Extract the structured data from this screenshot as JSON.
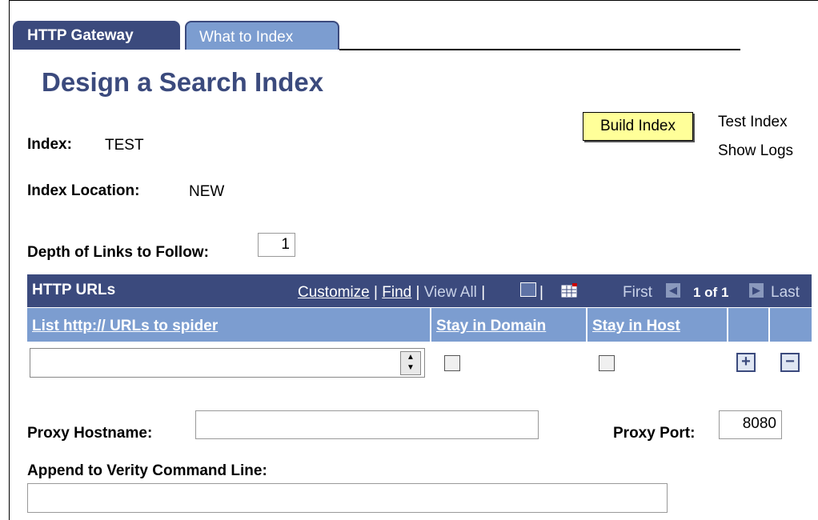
{
  "tabs": [
    {
      "label": "HTTP Gateway",
      "active": true
    },
    {
      "label": "What to Index",
      "active": false
    }
  ],
  "page_title": "Design a Search Index",
  "actions": {
    "build_index": "Build Index",
    "test_index": "Test Index",
    "show_logs": "Show Logs"
  },
  "index": {
    "label": "Index:",
    "value": "TEST"
  },
  "index_location": {
    "label": "Index Location:",
    "value": "NEW"
  },
  "depth": {
    "label": "Depth of Links to Follow:",
    "value": "1"
  },
  "grid": {
    "title": "HTTP URLs",
    "customize": "Customize",
    "find": "Find",
    "view_all": "View All",
    "first": "First",
    "page_info": "1 of 1",
    "last": "Last",
    "columns": [
      "List http:// URLs to spider",
      "Stay in Domain",
      "Stay in Host"
    ],
    "row": {
      "url": "",
      "stay_in_domain": false,
      "stay_in_host": false
    },
    "add_symbol": "+",
    "remove_symbol": "−"
  },
  "proxy_hostname": {
    "label": "Proxy Hostname:",
    "value": ""
  },
  "proxy_port": {
    "label": "Proxy Port:",
    "value": "8080"
  },
  "append_cmd": {
    "label": "Append to Verity Command Line:",
    "value": ""
  },
  "colors": {
    "header": "#3b4a7d",
    "subheader": "#7c9dd0",
    "button_bg": "#ffff99"
  }
}
